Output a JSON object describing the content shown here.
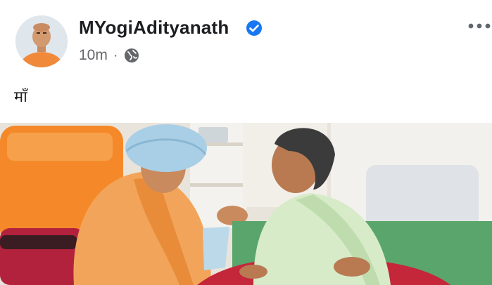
{
  "post": {
    "author": "MYogiAdityanath",
    "time": "10m",
    "separator": "·",
    "caption": "माँ"
  },
  "icons": {
    "verified": "verified-badge-icon",
    "audience": "globe-icon",
    "more": "more-options-icon"
  },
  "colors": {
    "verified_blue": "#1877f2",
    "meta_gray": "#65676b",
    "saffron": "#f0a050"
  }
}
